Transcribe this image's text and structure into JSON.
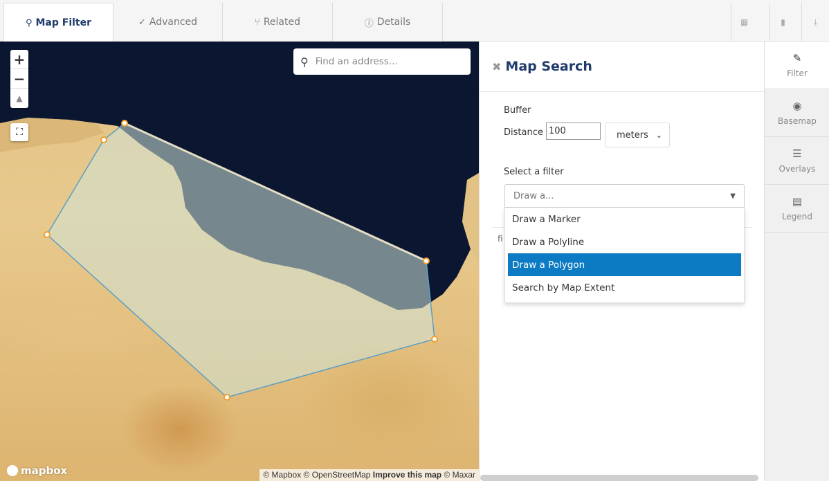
{
  "tabs": [
    {
      "label": "Map Filter",
      "icon": "map-marker-icon",
      "glyph": "⚲",
      "active": true
    },
    {
      "label": "Advanced",
      "icon": "check-circle-icon",
      "glyph": "✓",
      "active": false
    },
    {
      "label": "Related",
      "icon": "fork-icon",
      "glyph": "⑂",
      "active": false
    },
    {
      "label": "Details",
      "icon": "info-icon",
      "glyph": "ⓘ",
      "active": false
    }
  ],
  "toolbar_icons": [
    {
      "name": "calendar-icon",
      "glyph": "▦"
    },
    {
      "name": "bookmark-icon",
      "glyph": "▮"
    },
    {
      "name": "download-icon",
      "glyph": "⤓"
    }
  ],
  "map": {
    "zoom_in": "+",
    "zoom_out": "−",
    "compass": "▲",
    "fullscreen": "⛶",
    "search_placeholder": "Find an address...",
    "search_icon": "search-icon",
    "logo_text": "mapbox",
    "attribution": {
      "mapbox": "© Mapbox",
      "osm": "© OpenStreetMap",
      "improve": "Improve this map",
      "maxar": "© Maxar"
    }
  },
  "panel": {
    "close": "✖",
    "title": "Map Search",
    "buffer_label": "Buffer",
    "distance_label": "Distance",
    "distance_value": "100",
    "unit": "meters",
    "filter_label": "Select a filter",
    "filter_placeholder": "Draw a...",
    "options": [
      "Draw a Marker",
      "Draw a Polyline",
      "Draw a Polygon",
      "Search by Map Extent"
    ],
    "selected_option": "Draw a Polygon",
    "obscured_text": "fi"
  },
  "sidebar": [
    {
      "label": "Filter",
      "icon": "pencil-icon",
      "glyph": "✎",
      "active": true
    },
    {
      "label": "Basemap",
      "icon": "globe-icon",
      "glyph": "◉",
      "active": false
    },
    {
      "label": "Overlays",
      "icon": "list-icon",
      "glyph": "☰",
      "active": false
    },
    {
      "label": "Legend",
      "icon": "legend-icon",
      "glyph": "▤",
      "active": false
    }
  ],
  "colors": {
    "accent": "#1f3b6b",
    "selected": "#0d7bc4",
    "sea": "#0b1731",
    "polygon_fill": "#cfe3d8",
    "polygon_stroke": "#5b9fc4",
    "vertex": "#f0a030"
  }
}
